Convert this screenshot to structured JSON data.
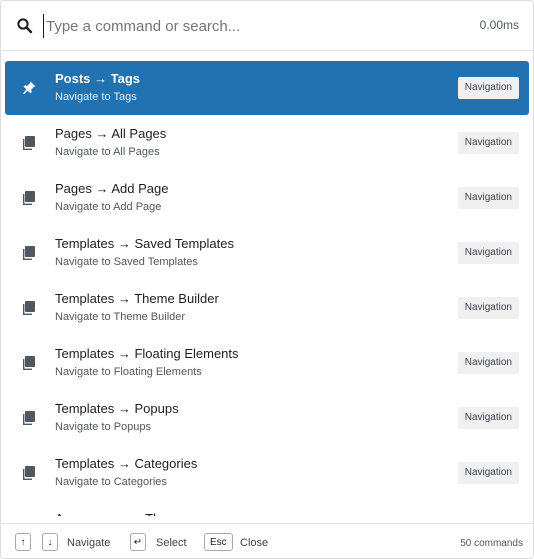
{
  "search": {
    "placeholder": "Type a command or search...",
    "value": "",
    "timing": "0.00ms"
  },
  "results": [
    {
      "title": "Posts → Tags",
      "subtitle": "Navigate to Tags",
      "badge": "Navigation",
      "icon": "pin-icon",
      "active": true
    },
    {
      "title": "Pages → All Pages",
      "subtitle": "Navigate to All Pages",
      "badge": "Navigation",
      "icon": "pages-icon",
      "active": false
    },
    {
      "title": "Pages → Add Page",
      "subtitle": "Navigate to Add Page",
      "badge": "Navigation",
      "icon": "pages-icon",
      "active": false
    },
    {
      "title": "Templates → Saved Templates",
      "subtitle": "Navigate to Saved Templates",
      "badge": "Navigation",
      "icon": "pages-icon",
      "active": false
    },
    {
      "title": "Templates → Theme Builder",
      "subtitle": "Navigate to Theme Builder",
      "badge": "Navigation",
      "icon": "pages-icon",
      "active": false
    },
    {
      "title": "Templates → Floating Elements",
      "subtitle": "Navigate to Floating Elements",
      "badge": "Navigation",
      "icon": "pages-icon",
      "active": false
    },
    {
      "title": "Templates → Popups",
      "subtitle": "Navigate to Popups",
      "badge": "Navigation",
      "icon": "pages-icon",
      "active": false
    },
    {
      "title": "Templates → Categories",
      "subtitle": "Navigate to Categories",
      "badge": "Navigation",
      "icon": "pages-icon",
      "active": false
    },
    {
      "title": "Appearance → Themes",
      "subtitle": "",
      "badge": "",
      "icon": "pages-icon",
      "active": false
    }
  ],
  "footer": {
    "up_key": "↑",
    "down_key": "↓",
    "navigate_label": "Navigate",
    "enter_key": "↵",
    "select_label": "Select",
    "esc_key": "Esc",
    "close_label": "Close",
    "command_count": "50 commands"
  },
  "colors": {
    "accent": "#2271b1",
    "badge_bg": "#f0f0f1",
    "icon": "#50575e"
  }
}
